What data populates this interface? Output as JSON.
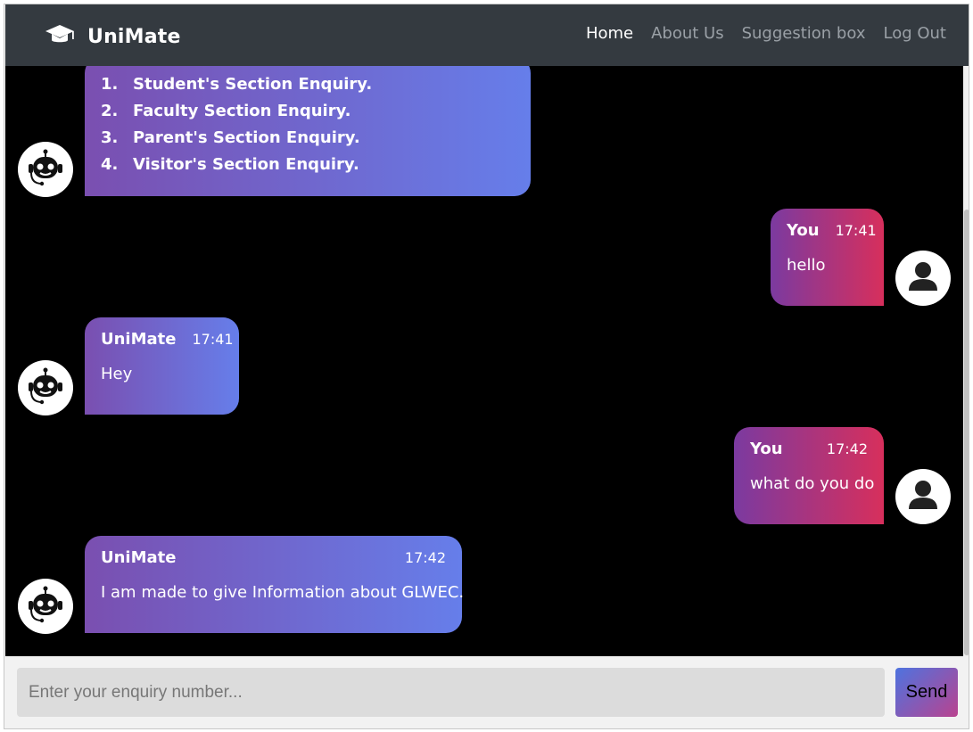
{
  "navbar": {
    "brand": "UniMate",
    "links": [
      {
        "label": "Home",
        "active": true
      },
      {
        "label": "About Us",
        "active": false
      },
      {
        "label": "Suggestion box",
        "active": false
      },
      {
        "label": "Log Out",
        "active": false
      }
    ]
  },
  "messages": {
    "bot_menu": {
      "items": [
        {
          "num": "1.",
          "label": "Student's Section Enquiry."
        },
        {
          "num": "2.",
          "label": "Faculty Section Enquiry."
        },
        {
          "num": "3.",
          "label": "Parent's Section Enquiry."
        },
        {
          "num": "4.",
          "label": "Visitor's Section Enquiry."
        }
      ]
    },
    "user_1": {
      "sender": "You",
      "time": "17:41",
      "text": "hello"
    },
    "bot_1": {
      "sender": "UniMate",
      "time": "17:41",
      "text": "Hey"
    },
    "user_2": {
      "sender": "You",
      "time": "17:42",
      "text": "what do you do"
    },
    "bot_2": {
      "sender": "UniMate",
      "time": "17:42",
      "text": "I am made to give Information about GLWEC."
    }
  },
  "input": {
    "placeholder": "Enter your enquiry number...",
    "send_label": "Send"
  },
  "colors": {
    "navbar_bg": "#343a40",
    "chat_bg": "#000000",
    "bot_bubble_gradient": [
      "#7a4fb0",
      "#667eea"
    ],
    "user_bubble_gradient": [
      "#7b3aa0",
      "#d72f5c"
    ]
  },
  "icons": {
    "brand": "graduation-cap-icon",
    "bot_avatar": "robot-icon",
    "user_avatar": "user-icon"
  }
}
